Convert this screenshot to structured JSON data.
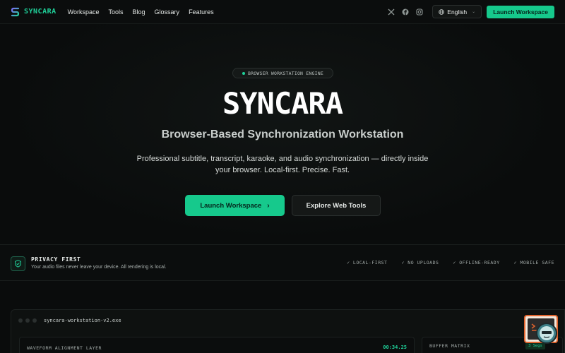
{
  "nav": {
    "brand": "SYNCARA",
    "links": [
      "Workspace",
      "Tools",
      "Blog",
      "Glossary",
      "Features"
    ],
    "social": [
      "x-icon",
      "facebook-icon",
      "instagram-icon"
    ],
    "language": "English",
    "launch_label": "Launch Workspace"
  },
  "hero": {
    "badge": "BROWSER WORKSTATION ENGINE",
    "title": "SYNCARA",
    "subtitle": "Browser-Based Synchronization Workstation",
    "description": "Professional subtitle, transcript, karaoke, and audio synchronization — directly inside your browser. Local-first. Precise. Fast.",
    "primary_button": "Launch Workspace",
    "secondary_button": "Explore Web Tools"
  },
  "privacy": {
    "title": "PRIVACY FIRST",
    "text": "Your audio files never leave your device. All rendering is local.",
    "features": [
      "✓ LOCAL-FIRST",
      "✓ NO UPLOADS",
      "✓ OFFLINE-READY",
      "✓ MOBILE SAFE"
    ]
  },
  "workstation": {
    "window_title": "syncara-workstation-v2.exe",
    "waveform_label": "WAVEFORM ALIGNMENT LAYER",
    "timecode": "00:34.25",
    "buffer_label": "BUFFER MATRIX",
    "segments": "3 Segs"
  },
  "colors": {
    "accent": "#16c98c",
    "background": "#0a0c0c",
    "widget_border": "#e0632d"
  }
}
